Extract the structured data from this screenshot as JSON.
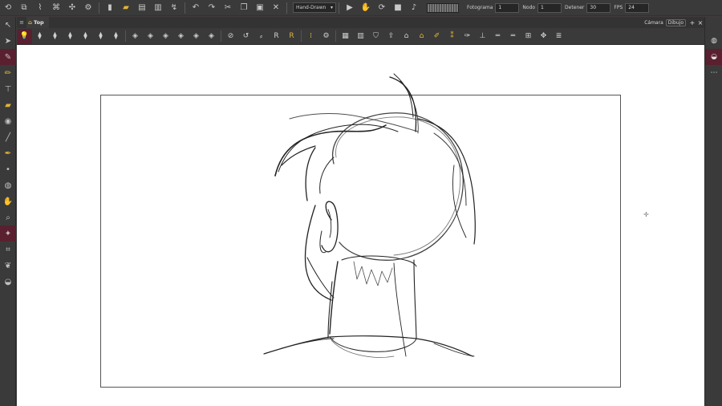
{
  "topbar": {
    "mode_select": "Hand-Drawn",
    "frame_label": "Fotograma",
    "frame_value": "1",
    "node_label": "Nodo",
    "node_value": "1",
    "stop_label": "Detener",
    "stop_value": "30",
    "fps_label": "FPS",
    "fps_value": "24"
  },
  "view": {
    "tab_title": "Top",
    "camera_label": "Cámara",
    "drawing_button": "Dibujo",
    "add_icon": "+",
    "close_icon": "×"
  },
  "icons": {
    "colors": {
      "accent": "#e0b437",
      "selected": "#5a2030",
      "canvas": "#ffffff",
      "panel": "#3a3a3a"
    }
  }
}
